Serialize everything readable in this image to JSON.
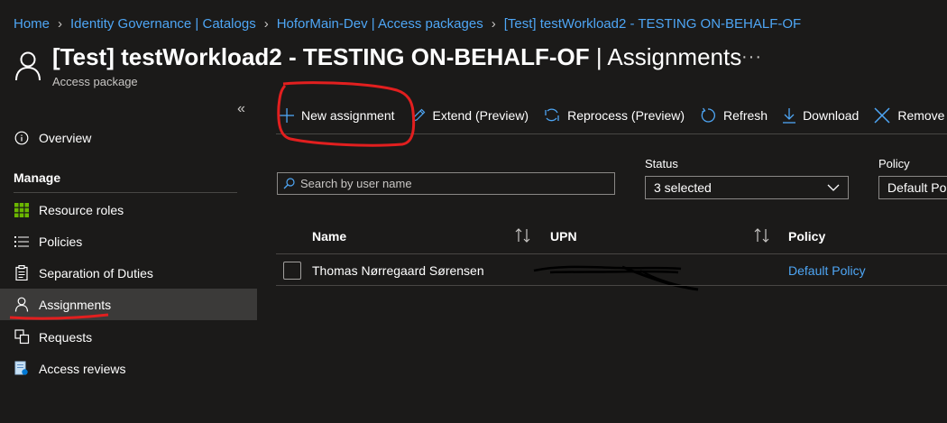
{
  "breadcrumb": [
    "Home",
    "Identity Governance | Catalogs",
    "HoforMain-Dev | Access packages",
    "[Test] testWorkload2 - TESTING ON-BEHALF-OF"
  ],
  "header": {
    "title_main": "[Test] testWorkload2 - TESTING ON-BEHALF-OF",
    "title_sep": " | ",
    "title_section": "Assignments",
    "subtitle": "Access package",
    "more": "···"
  },
  "sidebar": {
    "collapse": "«",
    "overview": "Overview",
    "section": "Manage",
    "items": [
      "Resource roles",
      "Policies",
      "Separation of Duties",
      "Assignments",
      "Requests",
      "Access reviews"
    ]
  },
  "toolbar": {
    "new_assignment": "New assignment",
    "extend": "Extend (Preview)",
    "reprocess": "Reprocess (Preview)",
    "refresh": "Refresh",
    "download": "Download",
    "remove": "Remove"
  },
  "filters": {
    "search_placeholder": "Search by user name",
    "status_label": "Status",
    "status_value": "3 selected",
    "policy_label": "Policy",
    "policy_value": "Default Policy"
  },
  "table": {
    "columns": [
      "Name",
      "UPN",
      "Policy"
    ],
    "rows": [
      {
        "name": "Thomas Nørregaard Sørensen",
        "policy": "Default Policy"
      }
    ]
  },
  "colors": {
    "background": "#1b1a19",
    "link": "#4ea6f5",
    "active_nav": "#3b3a39",
    "annotation": "#e21f1f"
  }
}
